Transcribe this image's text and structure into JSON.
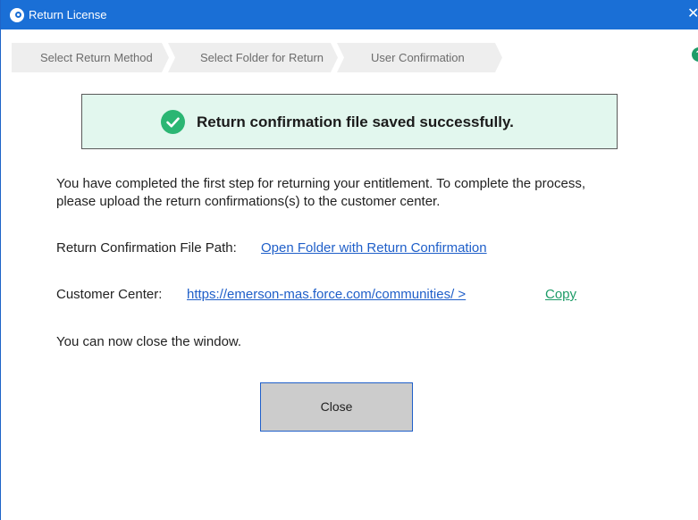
{
  "window": {
    "title": "Return License",
    "close_glyph": "✕",
    "app_icon": "key-icon"
  },
  "steps": [
    {
      "label": "Select Return Method"
    },
    {
      "label": "Select Folder for Return"
    },
    {
      "label": "User Confirmation"
    }
  ],
  "help": {
    "glyph": "?",
    "icon": "help-icon"
  },
  "banner": {
    "icon": "check-circle-icon",
    "message": "Return confirmation file saved successfully.",
    "background_color": "#e2f7ee",
    "icon_color": "#2bb673"
  },
  "body": {
    "intro": "You have completed the first step for returning your entitlement. To complete the process, please upload the return confirmations(s) to the customer center.",
    "file_path_label": "Return Confirmation File Path:",
    "file_path_link": "Open Folder with Return Confirmation",
    "customer_center_label": "Customer Center:",
    "customer_center_link": "https://emerson-mas.force.com/communities/ >",
    "copy_label": "Copy",
    "close_note": "You can now close the window."
  },
  "buttons": {
    "close_label": "Close"
  },
  "colors": {
    "titlebar": "#1a6fd6",
    "link": "#1f5fc9",
    "accent_green": "#1e9c68"
  }
}
